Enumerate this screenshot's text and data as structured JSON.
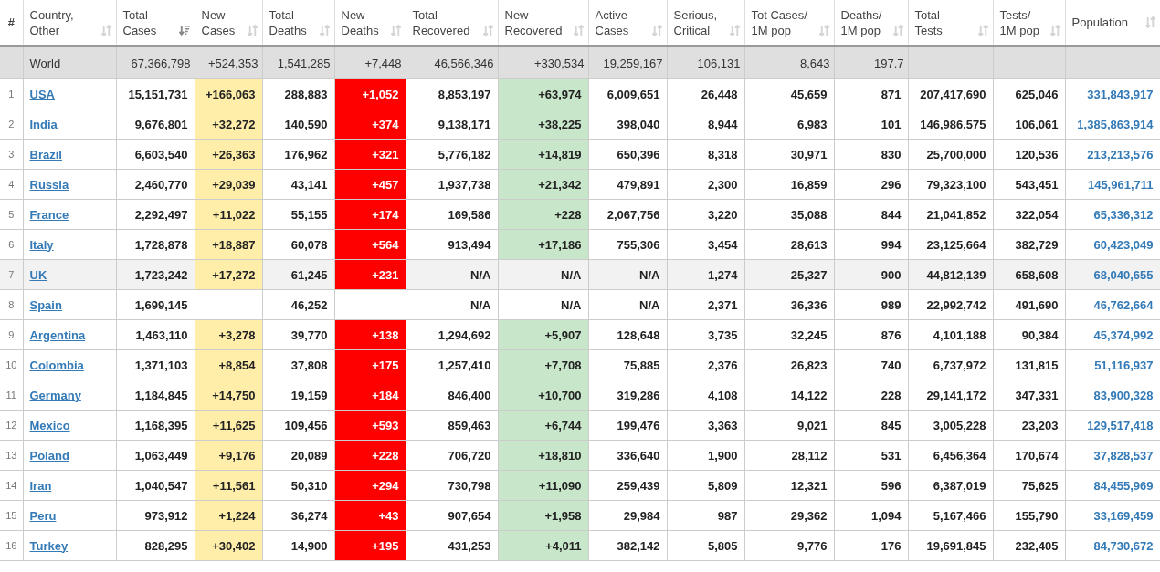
{
  "table": {
    "columns": [
      {
        "label": "#"
      },
      {
        "label": "Country,\nOther",
        "sorted": false
      },
      {
        "label": "Total\nCases",
        "sorted": true
      },
      {
        "label": "New\nCases",
        "sorted": false
      },
      {
        "label": "Total\nDeaths",
        "sorted": false
      },
      {
        "label": "New\nDeaths",
        "sorted": false
      },
      {
        "label": "Total\nRecovered",
        "sorted": false
      },
      {
        "label": "New\nRecovered",
        "sorted": false
      },
      {
        "label": "Active\nCases",
        "sorted": false
      },
      {
        "label": "Serious,\nCritical",
        "sorted": false
      },
      {
        "label": "Tot Cases/\n1M pop",
        "sorted": false
      },
      {
        "label": "Deaths/\n1M pop",
        "sorted": false
      },
      {
        "label": "Total\nTests",
        "sorted": false
      },
      {
        "label": "Tests/\n1M pop",
        "sorted": false
      },
      {
        "label": "Population",
        "sorted": false
      }
    ],
    "total_row": {
      "country": "World",
      "total_cases": "67,366,798",
      "new_cases": "+524,353",
      "total_deaths": "1,541,285",
      "new_deaths": "+7,448",
      "total_recovered": "46,566,346",
      "new_recovered": "+330,534",
      "active_cases": "19,259,167",
      "serious_critical": "106,131",
      "cases_per_1m": "8,643",
      "deaths_per_1m": "197.7"
    },
    "rows": [
      {
        "rank": "1",
        "country": "USA",
        "shaded": false,
        "total_cases": "15,151,731",
        "new_cases": "+166,063",
        "total_deaths": "288,883",
        "new_deaths": "+1,052",
        "total_recovered": "8,853,197",
        "new_recovered": "+63,974",
        "active_cases": "6,009,651",
        "serious_critical": "26,448",
        "cases_per_1m": "45,659",
        "deaths_per_1m": "871",
        "total_tests": "207,417,690",
        "tests_per_1m": "625,046",
        "population": "331,843,917"
      },
      {
        "rank": "2",
        "country": "India",
        "shaded": false,
        "total_cases": "9,676,801",
        "new_cases": "+32,272",
        "total_deaths": "140,590",
        "new_deaths": "+374",
        "total_recovered": "9,138,171",
        "new_recovered": "+38,225",
        "active_cases": "398,040",
        "serious_critical": "8,944",
        "cases_per_1m": "6,983",
        "deaths_per_1m": "101",
        "total_tests": "146,986,575",
        "tests_per_1m": "106,061",
        "population": "1,385,863,914"
      },
      {
        "rank": "3",
        "country": "Brazil",
        "shaded": false,
        "total_cases": "6,603,540",
        "new_cases": "+26,363",
        "total_deaths": "176,962",
        "new_deaths": "+321",
        "total_recovered": "5,776,182",
        "new_recovered": "+14,819",
        "active_cases": "650,396",
        "serious_critical": "8,318",
        "cases_per_1m": "30,971",
        "deaths_per_1m": "830",
        "total_tests": "25,700,000",
        "tests_per_1m": "120,536",
        "population": "213,213,576"
      },
      {
        "rank": "4",
        "country": "Russia",
        "shaded": false,
        "total_cases": "2,460,770",
        "new_cases": "+29,039",
        "total_deaths": "43,141",
        "new_deaths": "+457",
        "total_recovered": "1,937,738",
        "new_recovered": "+21,342",
        "active_cases": "479,891",
        "serious_critical": "2,300",
        "cases_per_1m": "16,859",
        "deaths_per_1m": "296",
        "total_tests": "79,323,100",
        "tests_per_1m": "543,451",
        "population": "145,961,711"
      },
      {
        "rank": "5",
        "country": "France",
        "shaded": false,
        "total_cases": "2,292,497",
        "new_cases": "+11,022",
        "total_deaths": "55,155",
        "new_deaths": "+174",
        "total_recovered": "169,586",
        "new_recovered": "+228",
        "active_cases": "2,067,756",
        "serious_critical": "3,220",
        "cases_per_1m": "35,088",
        "deaths_per_1m": "844",
        "total_tests": "21,041,852",
        "tests_per_1m": "322,054",
        "population": "65,336,312"
      },
      {
        "rank": "6",
        "country": "Italy",
        "shaded": false,
        "total_cases": "1,728,878",
        "new_cases": "+18,887",
        "total_deaths": "60,078",
        "new_deaths": "+564",
        "total_recovered": "913,494",
        "new_recovered": "+17,186",
        "active_cases": "755,306",
        "serious_critical": "3,454",
        "cases_per_1m": "28,613",
        "deaths_per_1m": "994",
        "total_tests": "23,125,664",
        "tests_per_1m": "382,729",
        "population": "60,423,049"
      },
      {
        "rank": "7",
        "country": "UK",
        "shaded": true,
        "total_cases": "1,723,242",
        "new_cases": "+17,272",
        "total_deaths": "61,245",
        "new_deaths": "+231",
        "total_recovered": "N/A",
        "new_recovered": "N/A",
        "active_cases": "N/A",
        "serious_critical": "1,274",
        "cases_per_1m": "25,327",
        "deaths_per_1m": "900",
        "total_tests": "44,812,139",
        "tests_per_1m": "658,608",
        "population": "68,040,655"
      },
      {
        "rank": "8",
        "country": "Spain",
        "shaded": false,
        "total_cases": "1,699,145",
        "total_deaths": "46,252",
        "total_recovered": "N/A",
        "new_recovered": "N/A",
        "active_cases": "N/A",
        "serious_critical": "2,371",
        "cases_per_1m": "36,336",
        "deaths_per_1m": "989",
        "total_tests": "22,992,742",
        "tests_per_1m": "491,690",
        "population": "46,762,664"
      },
      {
        "rank": "9",
        "country": "Argentina",
        "shaded": false,
        "total_cases": "1,463,110",
        "new_cases": "+3,278",
        "total_deaths": "39,770",
        "new_deaths": "+138",
        "total_recovered": "1,294,692",
        "new_recovered": "+5,907",
        "active_cases": "128,648",
        "serious_critical": "3,735",
        "cases_per_1m": "32,245",
        "deaths_per_1m": "876",
        "total_tests": "4,101,188",
        "tests_per_1m": "90,384",
        "population": "45,374,992"
      },
      {
        "rank": "10",
        "country": "Colombia",
        "shaded": false,
        "total_cases": "1,371,103",
        "new_cases": "+8,854",
        "total_deaths": "37,808",
        "new_deaths": "+175",
        "total_recovered": "1,257,410",
        "new_recovered": "+7,708",
        "active_cases": "75,885",
        "serious_critical": "2,376",
        "cases_per_1m": "26,823",
        "deaths_per_1m": "740",
        "total_tests": "6,737,972",
        "tests_per_1m": "131,815",
        "population": "51,116,937"
      },
      {
        "rank": "11",
        "country": "Germany",
        "shaded": false,
        "total_cases": "1,184,845",
        "new_cases": "+14,750",
        "total_deaths": "19,159",
        "new_deaths": "+184",
        "total_recovered": "846,400",
        "new_recovered": "+10,700",
        "active_cases": "319,286",
        "serious_critical": "4,108",
        "cases_per_1m": "14,122",
        "deaths_per_1m": "228",
        "total_tests": "29,141,172",
        "tests_per_1m": "347,331",
        "population": "83,900,328"
      },
      {
        "rank": "12",
        "country": "Mexico",
        "shaded": false,
        "total_cases": "1,168,395",
        "new_cases": "+11,625",
        "total_deaths": "109,456",
        "new_deaths": "+593",
        "total_recovered": "859,463",
        "new_recovered": "+6,744",
        "active_cases": "199,476",
        "serious_critical": "3,363",
        "cases_per_1m": "9,021",
        "deaths_per_1m": "845",
        "total_tests": "3,005,228",
        "tests_per_1m": "23,203",
        "population": "129,517,418"
      },
      {
        "rank": "13",
        "country": "Poland",
        "shaded": false,
        "total_cases": "1,063,449",
        "new_cases": "+9,176",
        "total_deaths": "20,089",
        "new_deaths": "+228",
        "total_recovered": "706,720",
        "new_recovered": "+18,810",
        "active_cases": "336,640",
        "serious_critical": "1,900",
        "cases_per_1m": "28,112",
        "deaths_per_1m": "531",
        "total_tests": "6,456,364",
        "tests_per_1m": "170,674",
        "population": "37,828,537"
      },
      {
        "rank": "14",
        "country": "Iran",
        "shaded": false,
        "total_cases": "1,040,547",
        "new_cases": "+11,561",
        "total_deaths": "50,310",
        "new_deaths": "+294",
        "total_recovered": "730,798",
        "new_recovered": "+11,090",
        "active_cases": "259,439",
        "serious_critical": "5,809",
        "cases_per_1m": "12,321",
        "deaths_per_1m": "596",
        "total_tests": "6,387,019",
        "tests_per_1m": "75,625",
        "population": "84,455,969"
      },
      {
        "rank": "15",
        "country": "Peru",
        "shaded": false,
        "total_cases": "973,912",
        "new_cases": "+1,224",
        "total_deaths": "36,274",
        "new_deaths": "+43",
        "total_recovered": "907,654",
        "new_recovered": "+1,958",
        "active_cases": "29,984",
        "serious_critical": "987",
        "cases_per_1m": "29,362",
        "deaths_per_1m": "1,094",
        "total_tests": "5,167,466",
        "tests_per_1m": "155,790",
        "population": "33,169,459"
      },
      {
        "rank": "16",
        "country": "Turkey",
        "shaded": false,
        "total_cases": "828,295",
        "new_cases": "+30,402",
        "total_deaths": "14,900",
        "new_deaths": "+195",
        "total_recovered": "431,253",
        "new_recovered": "+4,011",
        "active_cases": "382,142",
        "serious_critical": "5,805",
        "cases_per_1m": "9,776",
        "deaths_per_1m": "176",
        "total_tests": "19,691,845",
        "tests_per_1m": "232,405",
        "population": "84,730,672"
      }
    ]
  }
}
